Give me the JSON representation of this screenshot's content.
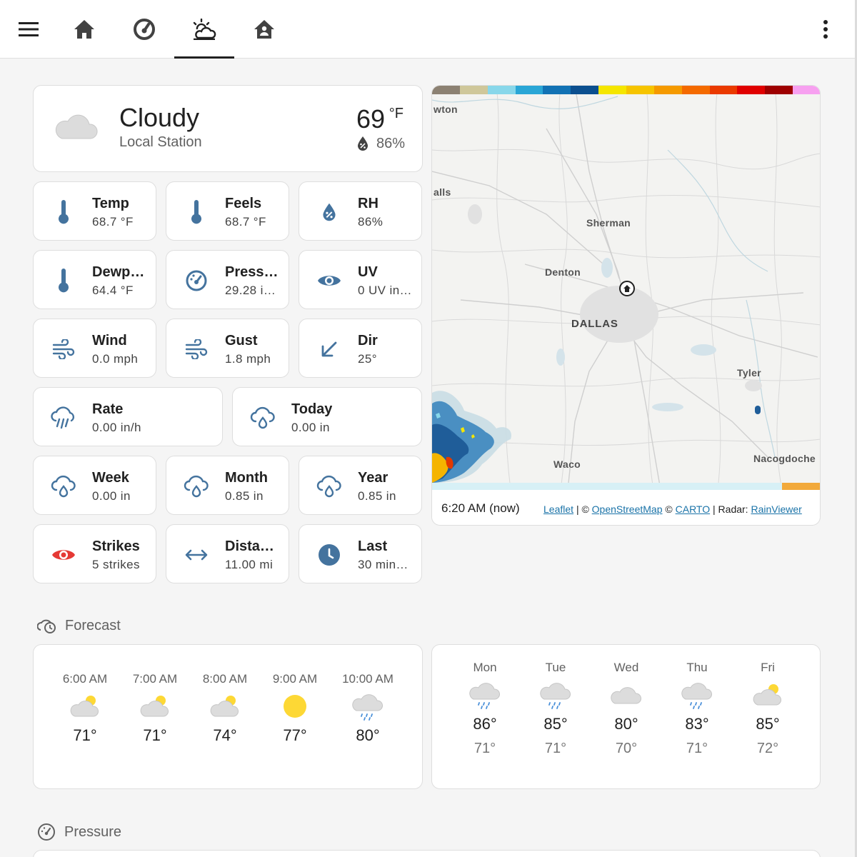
{
  "nav": {
    "menu_icon": "hamburger-menu-icon",
    "tabs": [
      {
        "name": "home",
        "icon": "home-icon"
      },
      {
        "name": "gauge",
        "icon": "speedometer-icon"
      },
      {
        "name": "weather",
        "icon": "weather-partly-cloudy-icon",
        "active": true
      },
      {
        "name": "house",
        "icon": "home-account-icon"
      }
    ],
    "overflow_icon": "dots-vertical-icon"
  },
  "current": {
    "condition": "Cloudy",
    "source": "Local Station",
    "temperature": "69",
    "unit": "°F",
    "humidity": "86%"
  },
  "tiles": [
    {
      "name": "Temp",
      "value": "68.7 °F",
      "icon": "thermometer-icon"
    },
    {
      "name": "Feels",
      "value": "68.7 °F",
      "icon": "thermometer-icon"
    },
    {
      "name": "RH",
      "value": "86%",
      "icon": "water-percent-icon"
    },
    {
      "name": "Dewp…",
      "value": "64.4 °F",
      "icon": "thermometer-icon"
    },
    {
      "name": "Press…",
      "value": "29.28 i…",
      "icon": "gauge-icon"
    },
    {
      "name": "UV",
      "value": "0 UV in…",
      "icon": "eye-icon"
    },
    {
      "name": "Wind",
      "value": "0.0 mph",
      "icon": "weather-windy-icon"
    },
    {
      "name": "Gust",
      "value": "1.8 mph",
      "icon": "weather-windy-icon"
    },
    {
      "name": "Dir",
      "value": "25°",
      "icon": "arrow-bottom-left-icon"
    },
    {
      "name": "Rate",
      "value": "0.00 in/h",
      "icon": "weather-pouring-icon"
    },
    {
      "name": "Today",
      "value": "0.00 in",
      "icon": "cloud-rain-drop-icon"
    },
    {
      "name": "Week",
      "value": "0.00 in",
      "icon": "cloud-rain-drop-icon"
    },
    {
      "name": "Month",
      "value": "0.85 in",
      "icon": "cloud-rain-drop-icon"
    },
    {
      "name": "Year",
      "value": "0.85 in",
      "icon": "cloud-rain-drop-icon"
    },
    {
      "name": "Strikes",
      "value": "5 strikes",
      "icon": "eye-alert-icon"
    },
    {
      "name": "Dista…",
      "value": "11.00 mi",
      "icon": "arrow-left-right-icon"
    },
    {
      "name": "Last",
      "value": "30 min…",
      "icon": "clock-icon"
    }
  ],
  "map": {
    "cities": [
      "wton",
      "alls",
      "Sherman",
      "Denton",
      "DALLAS",
      "Tyler",
      "Waco",
      "Nacogdoche"
    ],
    "time": "6:20 AM (now)",
    "attribution": {
      "leaflet": "Leaflet",
      "sep1": "| ©",
      "osm": "OpenStreetMap",
      "sep2": "©",
      "carto": "CARTO",
      "sep3": "| Radar:",
      "rainviewer": "RainViewer"
    },
    "legend_colors": [
      "#8c8172",
      "#cfc79a",
      "#88d7ea",
      "#2aa6d6",
      "#1272b4",
      "#0b4f8f",
      "#f5e600",
      "#f6c400",
      "#f59a00",
      "#f46a00",
      "#ea3a00",
      "#e00000",
      "#9e0000",
      "#f7a0f0"
    ]
  },
  "forecast_section": {
    "title": "Forecast",
    "icon": "weather-cloudy-clock-icon"
  },
  "hourly": [
    {
      "time": "6:00 AM",
      "temp": "71°",
      "icon": "partly-cloudy-icon"
    },
    {
      "time": "7:00 AM",
      "temp": "71°",
      "icon": "partly-cloudy-icon"
    },
    {
      "time": "8:00 AM",
      "temp": "74°",
      "icon": "partly-cloudy-icon"
    },
    {
      "time": "9:00 AM",
      "temp": "77°",
      "icon": "sunny-icon"
    },
    {
      "time": "10:00 AM",
      "temp": "80°",
      "icon": "rainy-icon"
    }
  ],
  "daily": [
    {
      "day": "Mon",
      "high": "86°",
      "low": "71°",
      "icon": "rainy-icon"
    },
    {
      "day": "Tue",
      "high": "85°",
      "low": "71°",
      "icon": "rainy-icon"
    },
    {
      "day": "Wed",
      "high": "80°",
      "low": "70°",
      "icon": "cloudy-icon"
    },
    {
      "day": "Thu",
      "high": "83°",
      "low": "71°",
      "icon": "rainy-icon"
    },
    {
      "day": "Fri",
      "high": "85°",
      "low": "72°",
      "icon": "partly-cloudy-icon"
    }
  ],
  "pressure_section": {
    "title": "Pressure",
    "icon": "gauge-icon"
  }
}
